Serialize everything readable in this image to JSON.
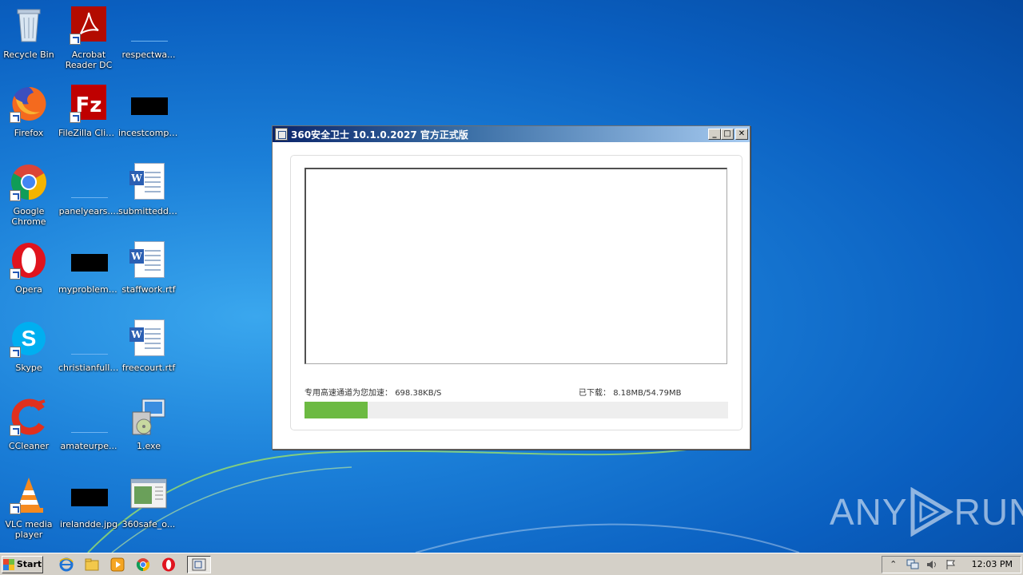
{
  "desktop": {
    "icons": [
      {
        "label": "Recycle Bin"
      },
      {
        "label": "Acrobat Reader DC"
      },
      {
        "label": "respectwa..."
      },
      {
        "label": "Firefox"
      },
      {
        "label": "FileZilla Client"
      },
      {
        "label": "incestcompa..."
      },
      {
        "label": "Google Chrome"
      },
      {
        "label": "panelyears...."
      },
      {
        "label": "submitteddu..."
      },
      {
        "label": "Opera"
      },
      {
        "label": "myproblems..."
      },
      {
        "label": "staffwork.rtf"
      },
      {
        "label": "Skype"
      },
      {
        "label": "christianfull...."
      },
      {
        "label": "freecourt.rtf"
      },
      {
        "label": "CCleaner"
      },
      {
        "label": "amateurpe..."
      },
      {
        "label": "1.exe"
      },
      {
        "label": "VLC media player"
      },
      {
        "label": "irelandde.jpg"
      },
      {
        "label": "360safe_o..."
      }
    ]
  },
  "window": {
    "title": "360安全卫士 10.1.0.2027 官方正式版",
    "minimize": "_",
    "maximize": "□",
    "close": "✕",
    "speed_label": "专用高速通道为您加速：",
    "speed_value": "698.38KB/S",
    "downloaded_label": "已下载：",
    "downloaded_value": "8.18MB/54.79MB",
    "progress_fraction": 0.149,
    "progress_color": "#6cba42"
  },
  "watermark": {
    "text_left": "ANY",
    "text_right": "RUN"
  },
  "taskbar": {
    "start_label": "Start",
    "quick_launch": [
      "ie-icon",
      "explorer-icon",
      "media-player-icon",
      "chrome-icon",
      "opera-icon"
    ],
    "clock": "12:03 PM"
  },
  "colors": {
    "desktop_blue": "#1b7fd8",
    "taskbar_gray": "#d4d0c8"
  }
}
